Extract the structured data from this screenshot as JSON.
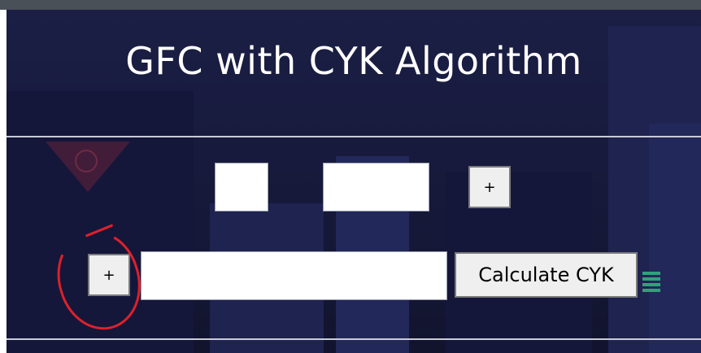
{
  "page": {
    "title": "GFC with CYK Algorithm"
  },
  "row1": {
    "field_a_value": "",
    "field_b_value": "",
    "add_button_label": "+"
  },
  "row2": {
    "add_button_label": "+",
    "input_value": "",
    "calculate_button_label": "Calculate CYK"
  },
  "colors": {
    "background": "#1b1f45",
    "separator": "#c9cbd6",
    "annotation": "#e0202a",
    "title_text": "#ffffff",
    "button_bg": "#efefef"
  },
  "icons": {
    "decorative_triangle": "triangle-eye-icon",
    "decorative_bars": "menu-bars-icon"
  }
}
